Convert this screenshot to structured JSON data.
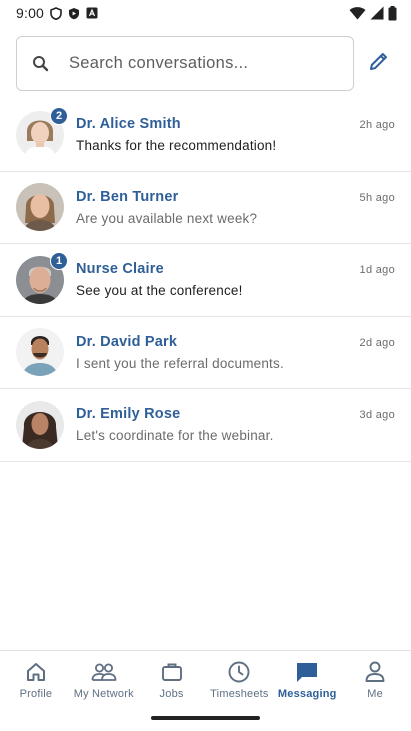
{
  "status_bar": {
    "time": "9:00",
    "left_icons": [
      "shield-icon",
      "play-protect-icon",
      "app-notification-icon"
    ],
    "right_icons": [
      "wifi-icon",
      "cell-signal-icon",
      "battery-icon"
    ]
  },
  "search": {
    "placeholder": "Search conversations...",
    "icon": "search-icon",
    "compose_icon": "pencil-icon"
  },
  "conversations": [
    {
      "name": "Dr. Alice Smith",
      "preview": "Thanks for the recommendation!",
      "time": "2h ago",
      "unread": "2"
    },
    {
      "name": "Dr. Ben Turner",
      "preview": "Are you available next week?",
      "time": "5h ago"
    },
    {
      "name": "Nurse Claire",
      "preview": "See you at the conference!",
      "time": "1d ago",
      "unread": "1"
    },
    {
      "name": "Dr. David Park",
      "preview": "I sent you the referral documents.",
      "time": "2d ago"
    },
    {
      "name": "Dr. Emily Rose",
      "preview": "Let's coordinate for the webinar.",
      "time": "3d ago"
    }
  ],
  "bottom_nav": {
    "items": [
      {
        "label": "Profile",
        "icon": "home-icon"
      },
      {
        "label": "My Network",
        "icon": "people-icon"
      },
      {
        "label": "Jobs",
        "icon": "briefcase-icon"
      },
      {
        "label": "Timesheets",
        "icon": "clock-icon"
      },
      {
        "label": "Messaging",
        "icon": "chat-icon",
        "active": true
      },
      {
        "label": "Me",
        "icon": "person-icon"
      }
    ]
  },
  "colors": {
    "accent": "#2f5f98",
    "nav_inactive": "#5f6f82",
    "divider": "#e6e6e6"
  }
}
